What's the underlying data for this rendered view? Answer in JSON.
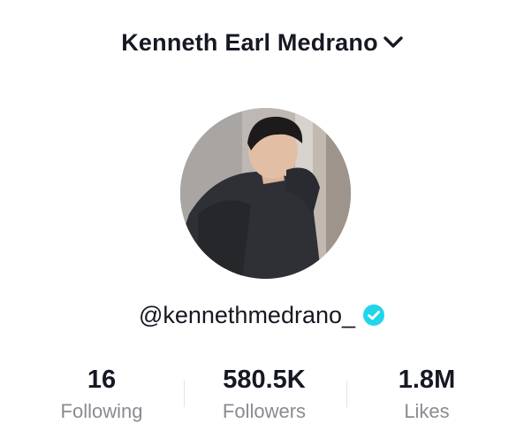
{
  "profile": {
    "display_name": "Kenneth Earl Medrano",
    "username": "@kennethmedrano_",
    "verified": true,
    "avatar_alt": "profile-photo"
  },
  "stats": [
    {
      "value": "16",
      "label": "Following"
    },
    {
      "value": "580.5K",
      "label": "Followers"
    },
    {
      "value": "1.8M",
      "label": "Likes"
    }
  ],
  "colors": {
    "text_primary": "#161823",
    "text_secondary": "#8a8b91",
    "verified_badge": "#20D5EC",
    "divider": "#e3e3e4"
  },
  "icons": {
    "title_dropdown": "chevron-down-icon",
    "badge": "verified-check-icon"
  }
}
